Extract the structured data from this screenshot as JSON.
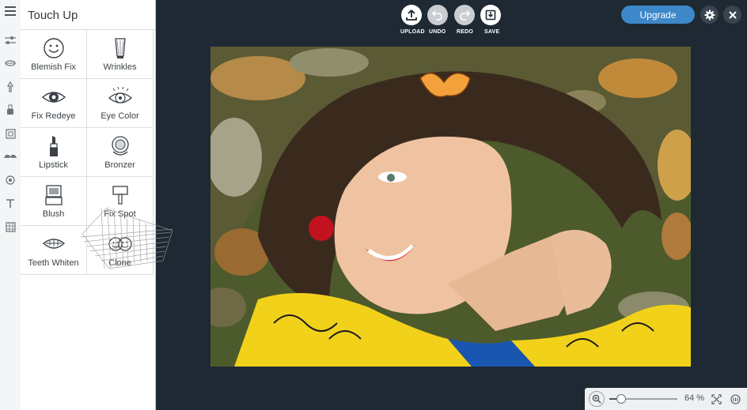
{
  "panel": {
    "title": "Touch Up",
    "tools": [
      {
        "label": "Blemish Fix",
        "icon": "smiley-icon"
      },
      {
        "label": "Wrinkles",
        "icon": "wrinkles-brush-icon"
      },
      {
        "label": "Fix Redeye",
        "icon": "redeye-icon"
      },
      {
        "label": "Eye Color",
        "icon": "eye-color-icon"
      },
      {
        "label": "Lipstick",
        "icon": "lipstick-icon"
      },
      {
        "label": "Bronzer",
        "icon": "bronzer-icon"
      },
      {
        "label": "Blush",
        "icon": "blush-icon"
      },
      {
        "label": "Fix Spot",
        "icon": "fix-spot-icon"
      },
      {
        "label": "Teeth Whiten",
        "icon": "teeth-icon"
      },
      {
        "label": "Clone",
        "icon": "clone-icon"
      }
    ]
  },
  "toolbar": {
    "upload_label": "UPLOAD",
    "undo_label": "UNDO",
    "redo_label": "REDO",
    "save_label": "SAVE",
    "upgrade_label": "Upgrade"
  },
  "zoom": {
    "value_label": "64 %",
    "level": 0.18
  },
  "rail_icons": [
    "menu-icon",
    "adjust-icon",
    "effects-icon",
    "touch-up-icon",
    "paint-icon",
    "frames-icon",
    "mustache-icon",
    "overlays-icon",
    "text-icon",
    "texture-icon"
  ],
  "colors": {
    "canvas_bg": "#1e2933",
    "accent": "#3d88c9"
  }
}
